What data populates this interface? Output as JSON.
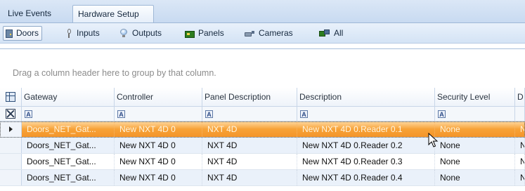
{
  "tabs": [
    {
      "label": "Live Events",
      "active": false
    },
    {
      "label": "Hardware Setup",
      "active": true
    }
  ],
  "toolbar": {
    "items": [
      {
        "label": "Doors",
        "icon": "door-icon",
        "active": true
      },
      {
        "label": "Inputs",
        "icon": "input-icon",
        "active": false
      },
      {
        "label": "Outputs",
        "icon": "output-bulb-icon",
        "active": false
      },
      {
        "label": "Panels",
        "icon": "panel-icon",
        "active": false
      },
      {
        "label": "Cameras",
        "icon": "camera-icon",
        "active": false
      },
      {
        "label": "All",
        "icon": "all-hardware-icon",
        "active": false
      }
    ]
  },
  "grid": {
    "group_hint": "Drag a column header here to group by that column.",
    "columns": [
      "Gateway",
      "Controller",
      "Panel Description",
      "Description",
      "Security Level",
      "D"
    ],
    "filter_glyph": "A",
    "rows": [
      [
        "Doors_NET_Gat...",
        "New NXT 4D 0",
        "NXT 4D",
        "New NXT 4D 0.Reader 0.1",
        "None",
        "N"
      ],
      [
        "Doors_NET_Gat...",
        "New NXT 4D 0",
        "NXT 4D",
        "New NXT 4D 0.Reader 0.2",
        "None",
        "N"
      ],
      [
        "Doors_NET_Gat...",
        "New NXT 4D 0",
        "NXT 4D",
        "New NXT 4D 0.Reader 0.3",
        "None",
        "N"
      ],
      [
        "Doors_NET_Gat...",
        "New NXT 4D 0",
        "NXT 4D",
        "New NXT 4D 0.Reader 0.4",
        "None",
        "N"
      ]
    ],
    "selected_row": 0
  },
  "colors": {
    "selection_orange": "#f7a237",
    "tab_blue": "#c8daf1",
    "alt_row": "#eaf1fa"
  }
}
